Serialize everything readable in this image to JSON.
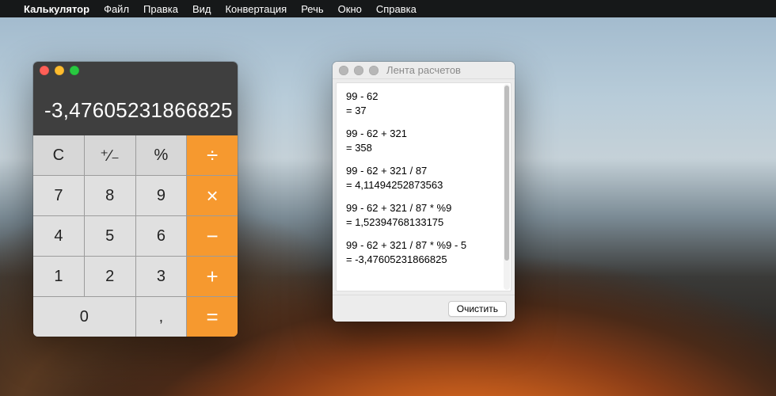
{
  "menubar": {
    "apple": "",
    "appname": "Калькулятор",
    "items": [
      "Файл",
      "Правка",
      "Вид",
      "Конвертация",
      "Речь",
      "Окно",
      "Справка"
    ]
  },
  "calculator": {
    "display": "-3,47605231866825",
    "keys": {
      "clear": "C",
      "sign": "⁺∕₋",
      "percent": "%",
      "divide": "÷",
      "k7": "7",
      "k8": "8",
      "k9": "9",
      "multiply": "×",
      "k4": "4",
      "k5": "5",
      "k6": "6",
      "minus": "−",
      "k1": "1",
      "k2": "2",
      "k3": "3",
      "plus": "+",
      "k0": "0",
      "decimal": ",",
      "equals": "="
    }
  },
  "tape": {
    "title": "Лента расчетов",
    "entries": [
      {
        "expr": "99 - 62",
        "result": "= 37"
      },
      {
        "expr": "99 - 62 + 321",
        "result": "= 358"
      },
      {
        "expr": "99 - 62 + 321 / 87",
        "result": "= 4,11494252873563"
      },
      {
        "expr": "99 - 62 + 321 / 87 * %9",
        "result": "= 1,52394768133175"
      },
      {
        "expr": "99 - 62 + 321 / 87 * %9 - 5",
        "result": "= -3,47605231866825"
      }
    ],
    "clear": "Очистить"
  }
}
